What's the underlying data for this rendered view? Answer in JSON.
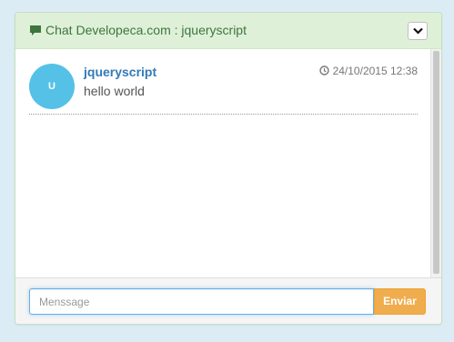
{
  "header": {
    "title": "Chat Developeca.com : jqueryscript",
    "icon": "chat-bubble-icon",
    "collapse_icon": "chevron-down-icon"
  },
  "messages": [
    {
      "avatar_letter": "U",
      "username": "jqueryscript",
      "timestamp": "24/10/2015 12:38",
      "timestamp_icon": "clock-icon",
      "text": "hello world"
    }
  ],
  "footer": {
    "input_placeholder": "Menssage",
    "input_value": "",
    "send_label": "Enviar"
  },
  "colors": {
    "header_bg": "#dff0d8",
    "header_text": "#3c763d",
    "avatar_bg": "#55c1e7",
    "username": "#337ab7",
    "send_button": "#f0ad4e",
    "page_bg": "#dbecf5"
  }
}
